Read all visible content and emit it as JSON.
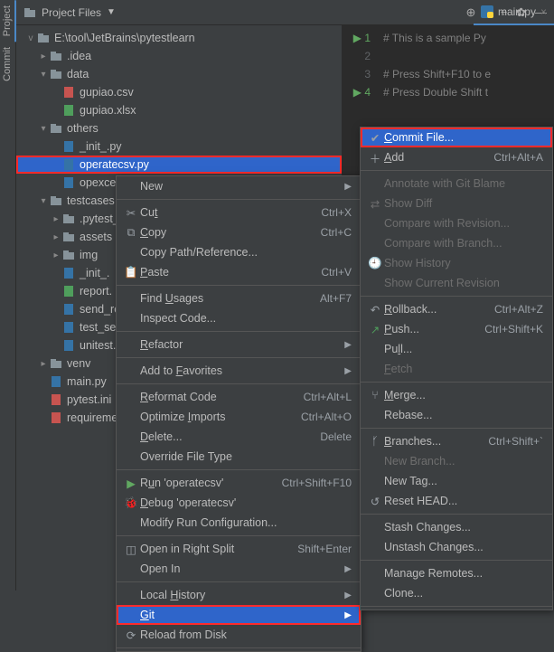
{
  "sidebar_vtabs": {
    "project": "Project",
    "commit": "Commit"
  },
  "header": {
    "title": "Project Files",
    "dropdown": "▼"
  },
  "editor": {
    "tab": {
      "name": "main.py"
    },
    "gutter": [
      "1",
      "2",
      "3",
      "4"
    ],
    "lines": [
      "# This is a sample Py",
      "",
      "# Press Shift+F10 to e",
      "# Press Double Shift t"
    ]
  },
  "tree": {
    "root": "E:\\tool\\JetBrains\\pytestlearn",
    "items": [
      {
        "pad": 2,
        "tw": ">",
        "type": "dir",
        "name": ".idea"
      },
      {
        "pad": 2,
        "tw": "v",
        "type": "dir",
        "name": "data"
      },
      {
        "pad": 3,
        "tw": "",
        "type": "csv",
        "name": "gupiao.csv"
      },
      {
        "pad": 3,
        "tw": "",
        "type": "xls",
        "name": "gupiao.xlsx"
      },
      {
        "pad": 2,
        "tw": "v",
        "type": "dir",
        "name": "others"
      },
      {
        "pad": 3,
        "tw": "",
        "type": "py",
        "name": "_init_.py"
      },
      {
        "pad": 3,
        "tw": "",
        "type": "py",
        "name": "operatecsv.py",
        "sel": true,
        "box": true
      },
      {
        "pad": 3,
        "tw": "",
        "type": "py",
        "name": "opexce"
      },
      {
        "pad": 2,
        "tw": "v",
        "type": "dir",
        "name": "testcases"
      },
      {
        "pad": 3,
        "tw": ">",
        "type": "dir",
        "name": ".pytest_"
      },
      {
        "pad": 3,
        "tw": ">",
        "type": "dir",
        "name": "assets"
      },
      {
        "pad": 3,
        "tw": ">",
        "type": "dir",
        "name": "img"
      },
      {
        "pad": 3,
        "tw": "",
        "type": "py",
        "name": "_init_."
      },
      {
        "pad": 3,
        "tw": "",
        "type": "html",
        "name": "report."
      },
      {
        "pad": 3,
        "tw": "",
        "type": "py",
        "name": "send_re"
      },
      {
        "pad": 3,
        "tw": "",
        "type": "py",
        "name": "test_se"
      },
      {
        "pad": 3,
        "tw": "",
        "type": "py",
        "name": "unitest."
      },
      {
        "pad": 2,
        "tw": ">",
        "type": "dir",
        "name": "venv"
      },
      {
        "pad": 2,
        "tw": "",
        "type": "py",
        "name": "main.py"
      },
      {
        "pad": 2,
        "tw": "",
        "type": "ini",
        "name": "pytest.ini"
      },
      {
        "pad": 2,
        "tw": "",
        "type": "txt",
        "name": "requireme"
      }
    ]
  },
  "ctx1": [
    {
      "label": "New",
      "arrow": true
    },
    {
      "sep": true
    },
    {
      "icon": "cut",
      "label": "Cut",
      "u": 2,
      "sc": "Ctrl+X"
    },
    {
      "icon": "copy",
      "label": "Copy",
      "u": 0,
      "sc": "Ctrl+C"
    },
    {
      "label": "Copy Path/Reference..."
    },
    {
      "icon": "paste",
      "label": "Paste",
      "u": 0,
      "sc": "Ctrl+V"
    },
    {
      "sep": true
    },
    {
      "label": "Find Usages",
      "u": 5,
      "sc": "Alt+F7"
    },
    {
      "label": "Inspect Code..."
    },
    {
      "sep": true
    },
    {
      "label": "Refactor",
      "u": 0,
      "arrow": true
    },
    {
      "sep": true
    },
    {
      "label": "Add to Favorites",
      "u": 7,
      "arrow": true
    },
    {
      "sep": true
    },
    {
      "label": "Reformat Code",
      "u": 0,
      "sc": "Ctrl+Alt+L"
    },
    {
      "label": "Optimize Imports",
      "u": 9,
      "sc": "Ctrl+Alt+O"
    },
    {
      "label": "Delete...",
      "u": 0,
      "sc": "Delete"
    },
    {
      "label": "Override File Type"
    },
    {
      "sep": true
    },
    {
      "icon": "run",
      "label": "Run 'operatecsv'",
      "u": 1,
      "sc": "Ctrl+Shift+F10"
    },
    {
      "icon": "debug",
      "label": "Debug 'operatecsv'",
      "u": 0
    },
    {
      "label": "Modify Run Configuration..."
    },
    {
      "sep": true
    },
    {
      "icon": "split",
      "label": "Open in Right Split",
      "sc": "Shift+Enter"
    },
    {
      "label": "Open In",
      "arrow": true
    },
    {
      "sep": true
    },
    {
      "label": "Local History",
      "u": 6,
      "arrow": true
    },
    {
      "label": "Git",
      "u": 0,
      "arrow": true,
      "sel": true,
      "box": true
    },
    {
      "icon": "reload",
      "label": "Reload from Disk"
    },
    {
      "sep": true
    }
  ],
  "ctx2": [
    {
      "icon": "commit",
      "label": "Commit File...",
      "u": 0,
      "sel": true,
      "box": true
    },
    {
      "icon": "add",
      "label": "Add",
      "u": 0,
      "sc": "Ctrl+Alt+A"
    },
    {
      "sep": true
    },
    {
      "label": "Annotate with Git Blame",
      "disabled": true
    },
    {
      "icon": "diff",
      "label": "Show Diff",
      "disabled": true
    },
    {
      "label": "Compare with Revision...",
      "disabled": true
    },
    {
      "label": "Compare with Branch...",
      "disabled": true
    },
    {
      "icon": "clock",
      "label": "Show History",
      "disabled": true
    },
    {
      "label": "Show Current Revision",
      "disabled": true
    },
    {
      "sep": true
    },
    {
      "icon": "rollback",
      "label": "Rollback...",
      "u": 0,
      "sc": "Ctrl+Alt+Z"
    },
    {
      "icon": "push",
      "label": "Push...",
      "u": 0,
      "sc": "Ctrl+Shift+K"
    },
    {
      "label": "Pull...",
      "u": 2
    },
    {
      "label": "Fetch",
      "u": 0,
      "disabled": true
    },
    {
      "sep": true
    },
    {
      "icon": "merge",
      "label": "Merge...",
      "u": 0
    },
    {
      "label": "Rebase..."
    },
    {
      "sep": true
    },
    {
      "icon": "branch",
      "label": "Branches...",
      "u": 0,
      "sc": "Ctrl+Shift+`"
    },
    {
      "label": "New Branch...",
      "disabled": true
    },
    {
      "label": "New Tag..."
    },
    {
      "icon": "reset",
      "label": "Reset HEAD..."
    },
    {
      "sep": true
    },
    {
      "label": "Stash Changes..."
    },
    {
      "label": "Unstash Changes..."
    },
    {
      "sep": true
    },
    {
      "label": "Manage Remotes..."
    },
    {
      "label": "Clone..."
    },
    {
      "sep": true
    }
  ]
}
